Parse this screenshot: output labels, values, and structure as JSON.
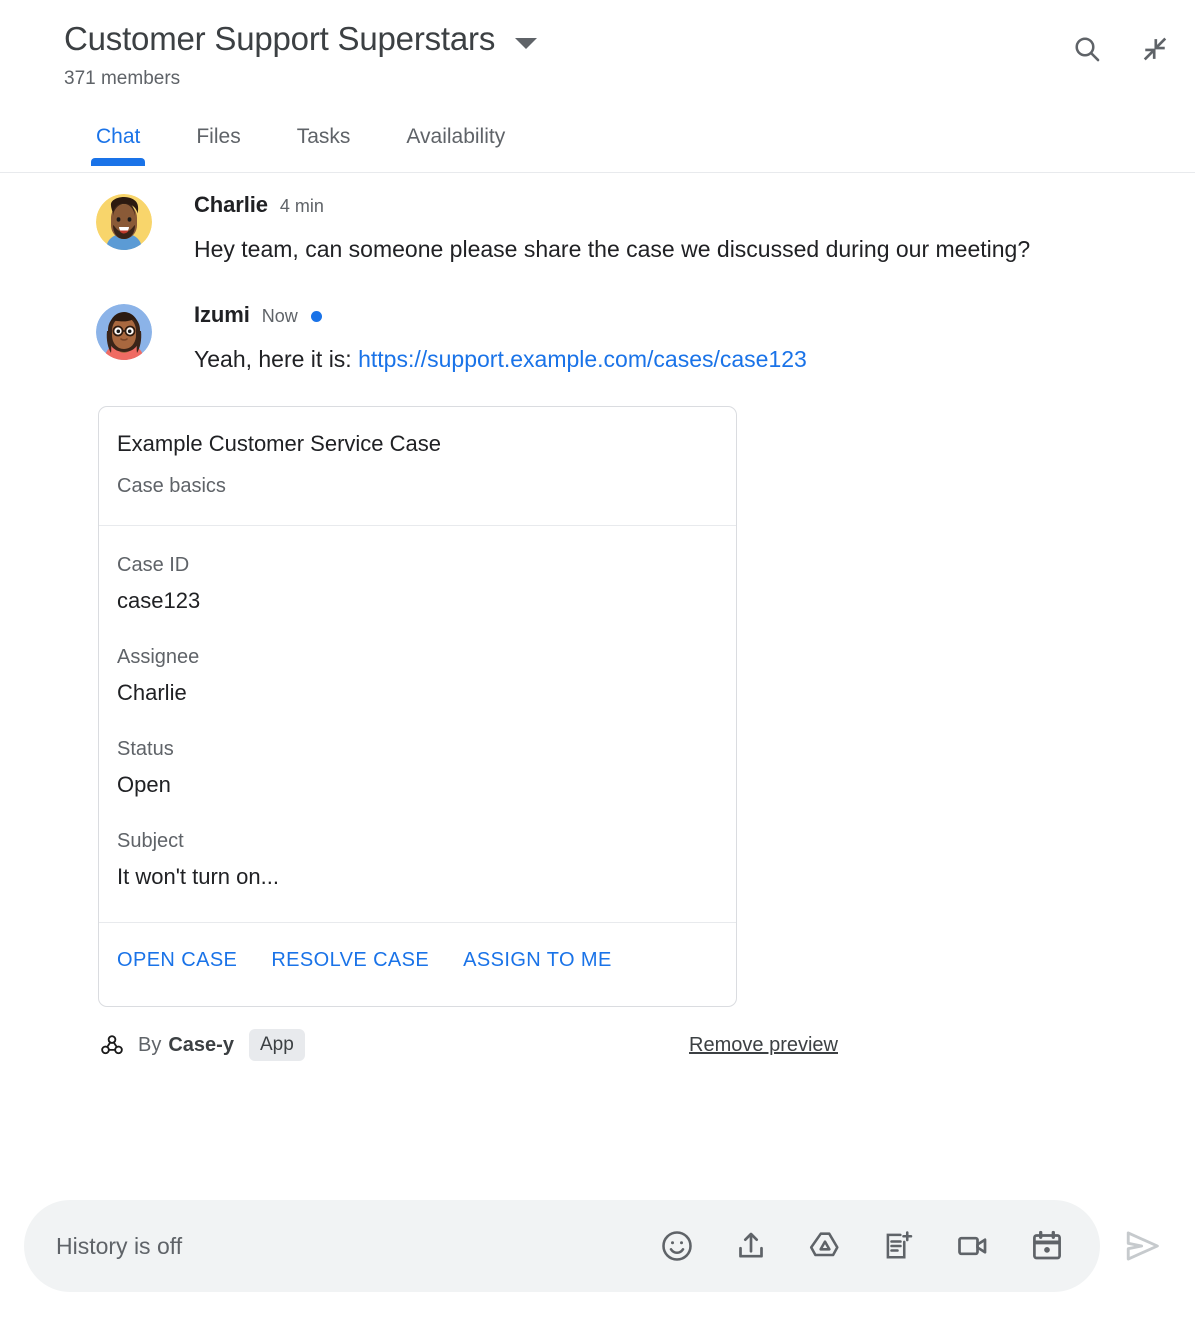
{
  "header": {
    "room_title": "Customer Support Superstars",
    "members": "371 members",
    "dropdown_icon": "chevron-down-icon",
    "search_icon": "search-icon",
    "collapse_icon": "collapse-arrows-icon"
  },
  "tabs": [
    {
      "label": "Chat",
      "active": true
    },
    {
      "label": "Files",
      "active": false
    },
    {
      "label": "Tasks",
      "active": false
    },
    {
      "label": "Availability",
      "active": false
    }
  ],
  "messages": [
    {
      "sender": "Charlie",
      "timestamp": "4 min",
      "unread": false,
      "text": "Hey team, can someone please share the case we discussed during our meeting?"
    },
    {
      "sender": "Izumi",
      "timestamp": "Now",
      "unread": true,
      "text_prefix": "Yeah, here it is: ",
      "link_text": "https://support.example.com/cases/case123"
    }
  ],
  "card": {
    "title": "Example Customer Service Case",
    "subtitle": "Case basics",
    "fields": [
      {
        "label": "Case ID",
        "value": "case123"
      },
      {
        "label": "Assignee",
        "value": "Charlie"
      },
      {
        "label": "Status",
        "value": "Open"
      },
      {
        "label": "Subject",
        "value": "It won't turn on..."
      }
    ],
    "actions": [
      "OPEN CASE",
      "RESOLVE CASE",
      "ASSIGN TO ME"
    ]
  },
  "attribution": {
    "icon": "webhook-icon",
    "by_label": "By",
    "app_name": "Case-y",
    "badge": "App",
    "remove_label": "Remove preview"
  },
  "composer": {
    "placeholder": "History is off",
    "icons": [
      "emoji-icon",
      "upload-icon",
      "google-drive-icon",
      "new-document-icon",
      "video-camera-icon",
      "calendar-icon"
    ],
    "send_icon": "send-icon"
  },
  "colors": {
    "accent": "#1a73e8",
    "text_primary": "#202124",
    "text_secondary": "#5f6368",
    "border": "#dadce0",
    "composer_bg": "#f1f3f4"
  }
}
